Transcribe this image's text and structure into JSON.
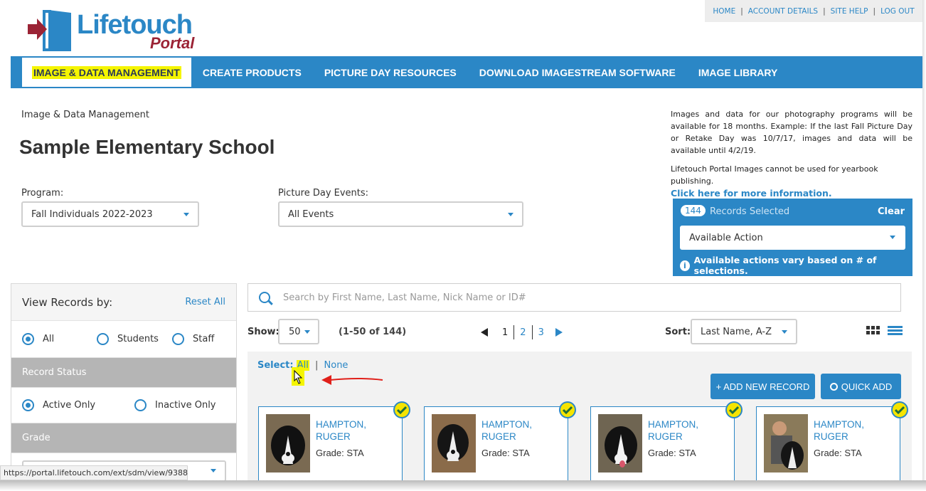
{
  "top_links": [
    "HOME",
    "ACCOUNT DETAILS",
    "SITE HELP",
    "LOG OUT"
  ],
  "logo": {
    "word1": "Lifetouch",
    "word2": "Portal"
  },
  "nav": [
    "IMAGE & DATA MANAGEMENT",
    "CREATE PRODUCTS",
    "PICTURE DAY RESOURCES",
    "DOWNLOAD IMAGESTREAM SOFTWARE",
    "IMAGE LIBRARY"
  ],
  "breadcrumb": "Image & Data Management",
  "school_name": "Sample Elementary School",
  "program": {
    "label": "Program:",
    "value": "Fall Individuals 2022-2023"
  },
  "events": {
    "label": "Picture Day Events:",
    "value": "All Events"
  },
  "info_text": "Images and data for our photography programs will be available for 18 months. Example: If the last Fall Picture Day or Retake Day was 10/7/17, images and data will be available until 4/2/19.",
  "info2_text": "Lifetouch Portal Images cannot be used for yearbook publishing.",
  "info2_link": "Click here for more information.",
  "selection": {
    "count": "144",
    "label": "Records Selected",
    "clear": "Clear",
    "action": "Available Action",
    "note": "Available actions vary based on # of selections."
  },
  "filters": {
    "title": "View Records by:",
    "reset": "Reset All",
    "view_options": [
      "All",
      "Students",
      "Staff"
    ],
    "status_header": "Record Status",
    "status_options": [
      "Active Only",
      "Inactive Only"
    ],
    "grade_header": "Grade"
  },
  "search_placeholder": "Search by First Name, Last Name, Nick Name or ID#",
  "toolbar": {
    "show_label": "Show:",
    "show_value": "50",
    "range": "(1-50 of 144)",
    "pages": [
      "1",
      "2",
      "3"
    ],
    "sort_label": "Sort:",
    "sort_value": "Last Name, A-Z"
  },
  "select_line": {
    "label": "Select:",
    "all": "All",
    "sep": "|",
    "none": "None"
  },
  "buttons": {
    "add": "+ ADD NEW RECORD",
    "quick": "QUICK ADD"
  },
  "cards": [
    {
      "last": "HAMPTON,",
      "first": "RUGER",
      "grade": "Grade: STA"
    },
    {
      "last": "HAMPTON,",
      "first": "RUGER",
      "grade": "Grade: STA"
    },
    {
      "last": "HAMPTON,",
      "first": "RUGER",
      "grade": "Grade: STA"
    },
    {
      "last": "HAMPTON,",
      "first": "RUGER",
      "grade": "Grade: STA"
    }
  ],
  "status_url": "https://portal.lifetouch.com/ext/sdm/view/9388",
  "colors": {
    "brand_blue": "#2b87c6",
    "highlight": "#f5f500",
    "logo_red": "#9b2335"
  }
}
